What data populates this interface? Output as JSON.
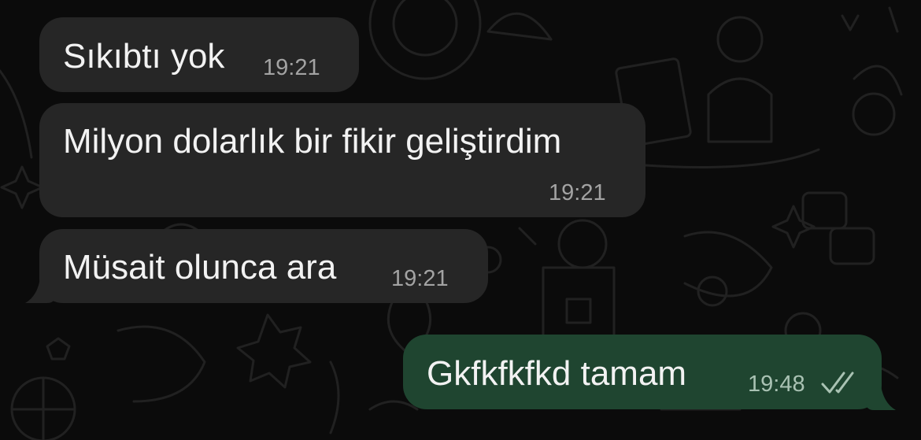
{
  "messages": [
    {
      "direction": "incoming",
      "text": "Sıkıbtı yok",
      "time": "19:21"
    },
    {
      "direction": "incoming",
      "text": "Milyon dolarlık bir fikir geliştirdim",
      "time": "19:21"
    },
    {
      "direction": "incoming",
      "text": "Müsait olunca ara",
      "time": "19:21"
    },
    {
      "direction": "outgoing",
      "text": "Gkfkfkfkd tamam",
      "time": "19:48",
      "status": "double-check-icon"
    }
  ],
  "colors": {
    "background": "#0b0b0b",
    "incoming_bubble": "#262626",
    "outgoing_bubble": "#1f4530",
    "wallpaper_doodle": "#222222"
  }
}
